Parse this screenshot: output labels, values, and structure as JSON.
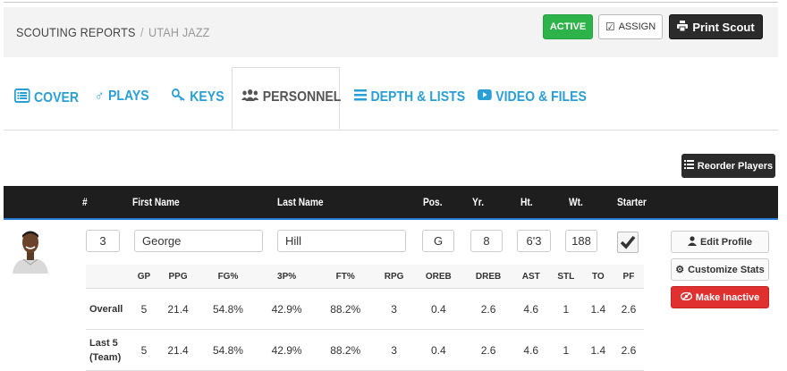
{
  "header": {
    "breadcrumb_root": "SCOUTING REPORTS",
    "breadcrumb_sep": "/",
    "breadcrumb_team": "UTAH JAZZ",
    "active_label": "ACTIVE",
    "assign_label": "ASSIGN",
    "print_label": "Print Scout"
  },
  "tabs": [
    {
      "label": "COVER",
      "icon": "list-alt-icon"
    },
    {
      "label": "PLAYS",
      "icon": "male-icon"
    },
    {
      "label": "KEYS",
      "icon": "key-icon"
    },
    {
      "label": "PERSONNEL",
      "icon": "group-icon",
      "active": true
    },
    {
      "label": "DEPTH & LISTS",
      "icon": "list-icon"
    },
    {
      "label": "VIDEO & FILES",
      "icon": "play-icon"
    }
  ],
  "reorder_label": "Reorder Players",
  "columns": [
    "#",
    "First Name",
    "Last Name",
    "Pos.",
    "Yr.",
    "Ht.",
    "Wt.",
    "Starter"
  ],
  "player": {
    "number": "3",
    "first_name": "George",
    "last_name": "Hill",
    "pos": "G",
    "yr": "8",
    "ht": "6'3",
    "wt": "188",
    "starter": true
  },
  "actions": {
    "edit": "Edit Profile",
    "customize": "Customize Stats",
    "inactive": "Make Inactive"
  },
  "stats": {
    "headers": [
      "GP",
      "PPG",
      "FG%",
      "3P%",
      "FT%",
      "RPG",
      "OREB",
      "DREB",
      "AST",
      "STL",
      "TO",
      "PF"
    ],
    "rows": [
      {
        "label": "Overall",
        "values": [
          "5",
          "21.4",
          "54.8%",
          "42.9%",
          "88.2%",
          "3",
          "0.4",
          "2.6",
          "4.6",
          "1",
          "1.4",
          "2.6"
        ]
      },
      {
        "label": "Last 5 (Team)",
        "values": [
          "5",
          "21.4",
          "54.8%",
          "42.9%",
          "88.2%",
          "3",
          "0.4",
          "2.6",
          "4.6",
          "1",
          "1.4",
          "2.6"
        ]
      }
    ]
  },
  "colors": {
    "accent": "#2a9fd6",
    "active_green": "#2db34a",
    "danger": "#e03030"
  }
}
